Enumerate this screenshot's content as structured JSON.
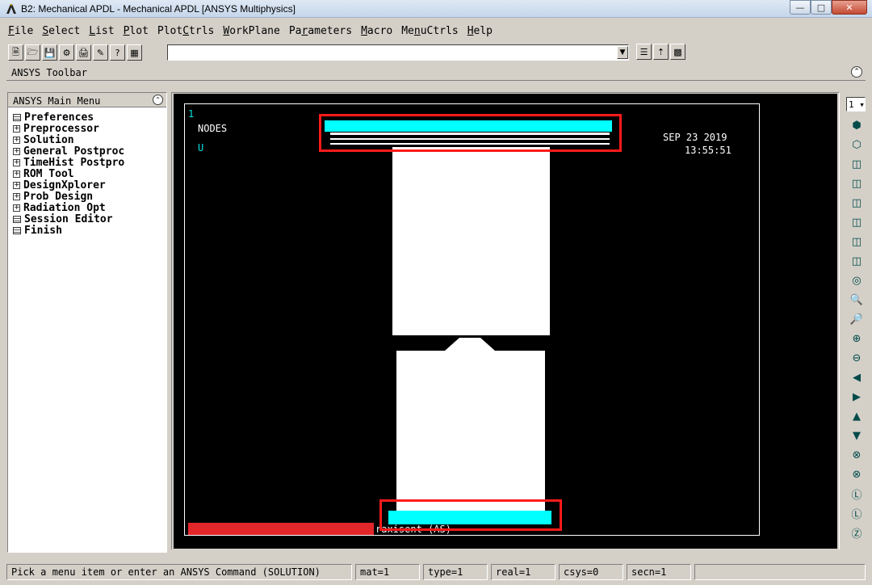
{
  "window": {
    "title": "B2: Mechanical APDL - Mechanical APDL [ANSYS Multiphysics]"
  },
  "menubar": [
    {
      "pre": "",
      "u": "F",
      "post": "ile"
    },
    {
      "pre": "",
      "u": "S",
      "post": "elect"
    },
    {
      "pre": "",
      "u": "L",
      "post": "ist"
    },
    {
      "pre": "",
      "u": "P",
      "post": "lot"
    },
    {
      "pre": "Plot",
      "u": "C",
      "post": "trls"
    },
    {
      "pre": "",
      "u": "W",
      "post": "orkPlane"
    },
    {
      "pre": "Pa",
      "u": "r",
      "post": "ameters"
    },
    {
      "pre": "",
      "u": "M",
      "post": "acro"
    },
    {
      "pre": "Me",
      "u": "n",
      "post": "uCtrls"
    },
    {
      "pre": "",
      "u": "H",
      "post": "elp"
    }
  ],
  "toolbar": {
    "command_value": ""
  },
  "ansys_toolbar": {
    "label": "ANSYS Toolbar"
  },
  "main_menu": {
    "title": "ANSYS Main Menu",
    "items": [
      {
        "label": "Preferences",
        "kind": "doc"
      },
      {
        "label": "Preprocessor",
        "kind": "plus"
      },
      {
        "label": "Solution",
        "kind": "plus"
      },
      {
        "label": "General Postproc",
        "kind": "plus"
      },
      {
        "label": "TimeHist Postpro",
        "kind": "plus"
      },
      {
        "label": "ROM Tool",
        "kind": "plus"
      },
      {
        "label": "DesignXplorer",
        "kind": "plus"
      },
      {
        "label": "Prob Design",
        "kind": "plus"
      },
      {
        "label": "Radiation Opt",
        "kind": "plus"
      },
      {
        "label": "Session Editor",
        "kind": "doc"
      },
      {
        "label": "Finish",
        "kind": "doc"
      }
    ]
  },
  "graphics": {
    "window_number": "1",
    "plot_type": "NODES",
    "dof_label": "U",
    "date": "SEP 23 2019",
    "time": "13:55:51",
    "bottom_label": "raxisent (AS)",
    "colors": {
      "background": "#000000",
      "model": "#ffffff",
      "constraints": "#00ffff",
      "highlight": "#ff1a1a"
    }
  },
  "rightbar": {
    "layer": "1"
  },
  "status": {
    "prompt": "Pick a menu item or enter an ANSYS Command (SOLUTION)",
    "mat": "mat=1",
    "type": "type=1",
    "real": "real=1",
    "csys": "csys=0",
    "secn": "secn=1"
  }
}
